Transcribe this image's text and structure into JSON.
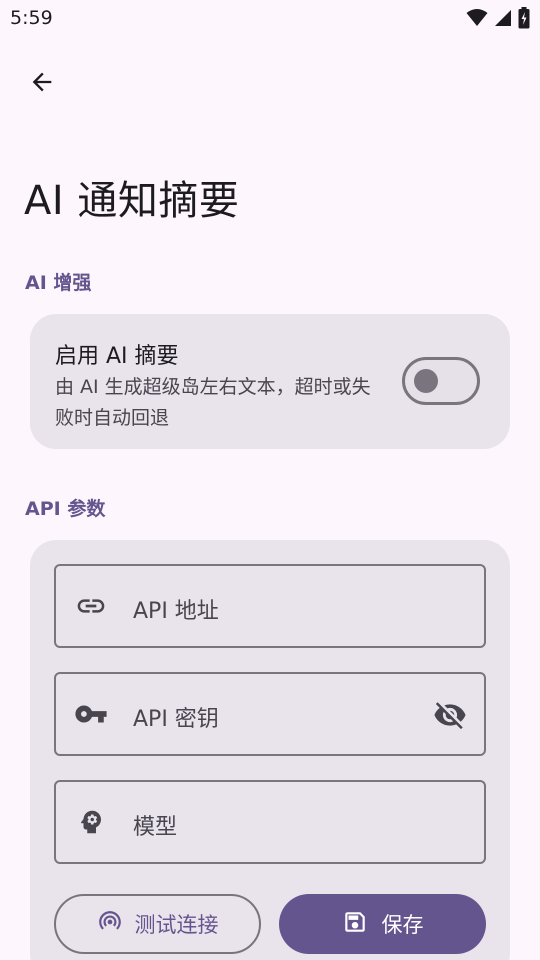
{
  "status_bar": {
    "time": "5:59",
    "icons": [
      "wifi-icon",
      "signal-icon",
      "battery-charging-icon"
    ]
  },
  "header": {
    "back_icon": "arrow-back-icon",
    "title": "AI 通知摘要"
  },
  "sections": {
    "ai_enhance": {
      "header": "AI 增强",
      "toggle": {
        "title": "启用 AI 摘要",
        "description": "由 AI 生成超级岛左右文本，超时或失败时自动回退",
        "enabled": false
      }
    },
    "api_params": {
      "header": "API 参数",
      "fields": {
        "url": {
          "placeholder": "API 地址",
          "value": "",
          "icon": "link-icon"
        },
        "key": {
          "placeholder": "API 密钥",
          "value": "",
          "icon": "key-icon",
          "trailing_icon": "visibility-off-icon"
        },
        "model": {
          "placeholder": "模型",
          "value": "",
          "icon": "psychology-icon"
        }
      },
      "buttons": {
        "test": {
          "label": "测试连接",
          "icon": "sensors-icon"
        },
        "save": {
          "label": "保存",
          "icon": "save-icon"
        }
      }
    }
  },
  "colors": {
    "background": "#fdf7fd",
    "card": "#e9e4ec",
    "primary": "#65558f",
    "outline": "#79747e",
    "on_surface": "#1d1b20",
    "on_surface_variant": "#49454f"
  }
}
